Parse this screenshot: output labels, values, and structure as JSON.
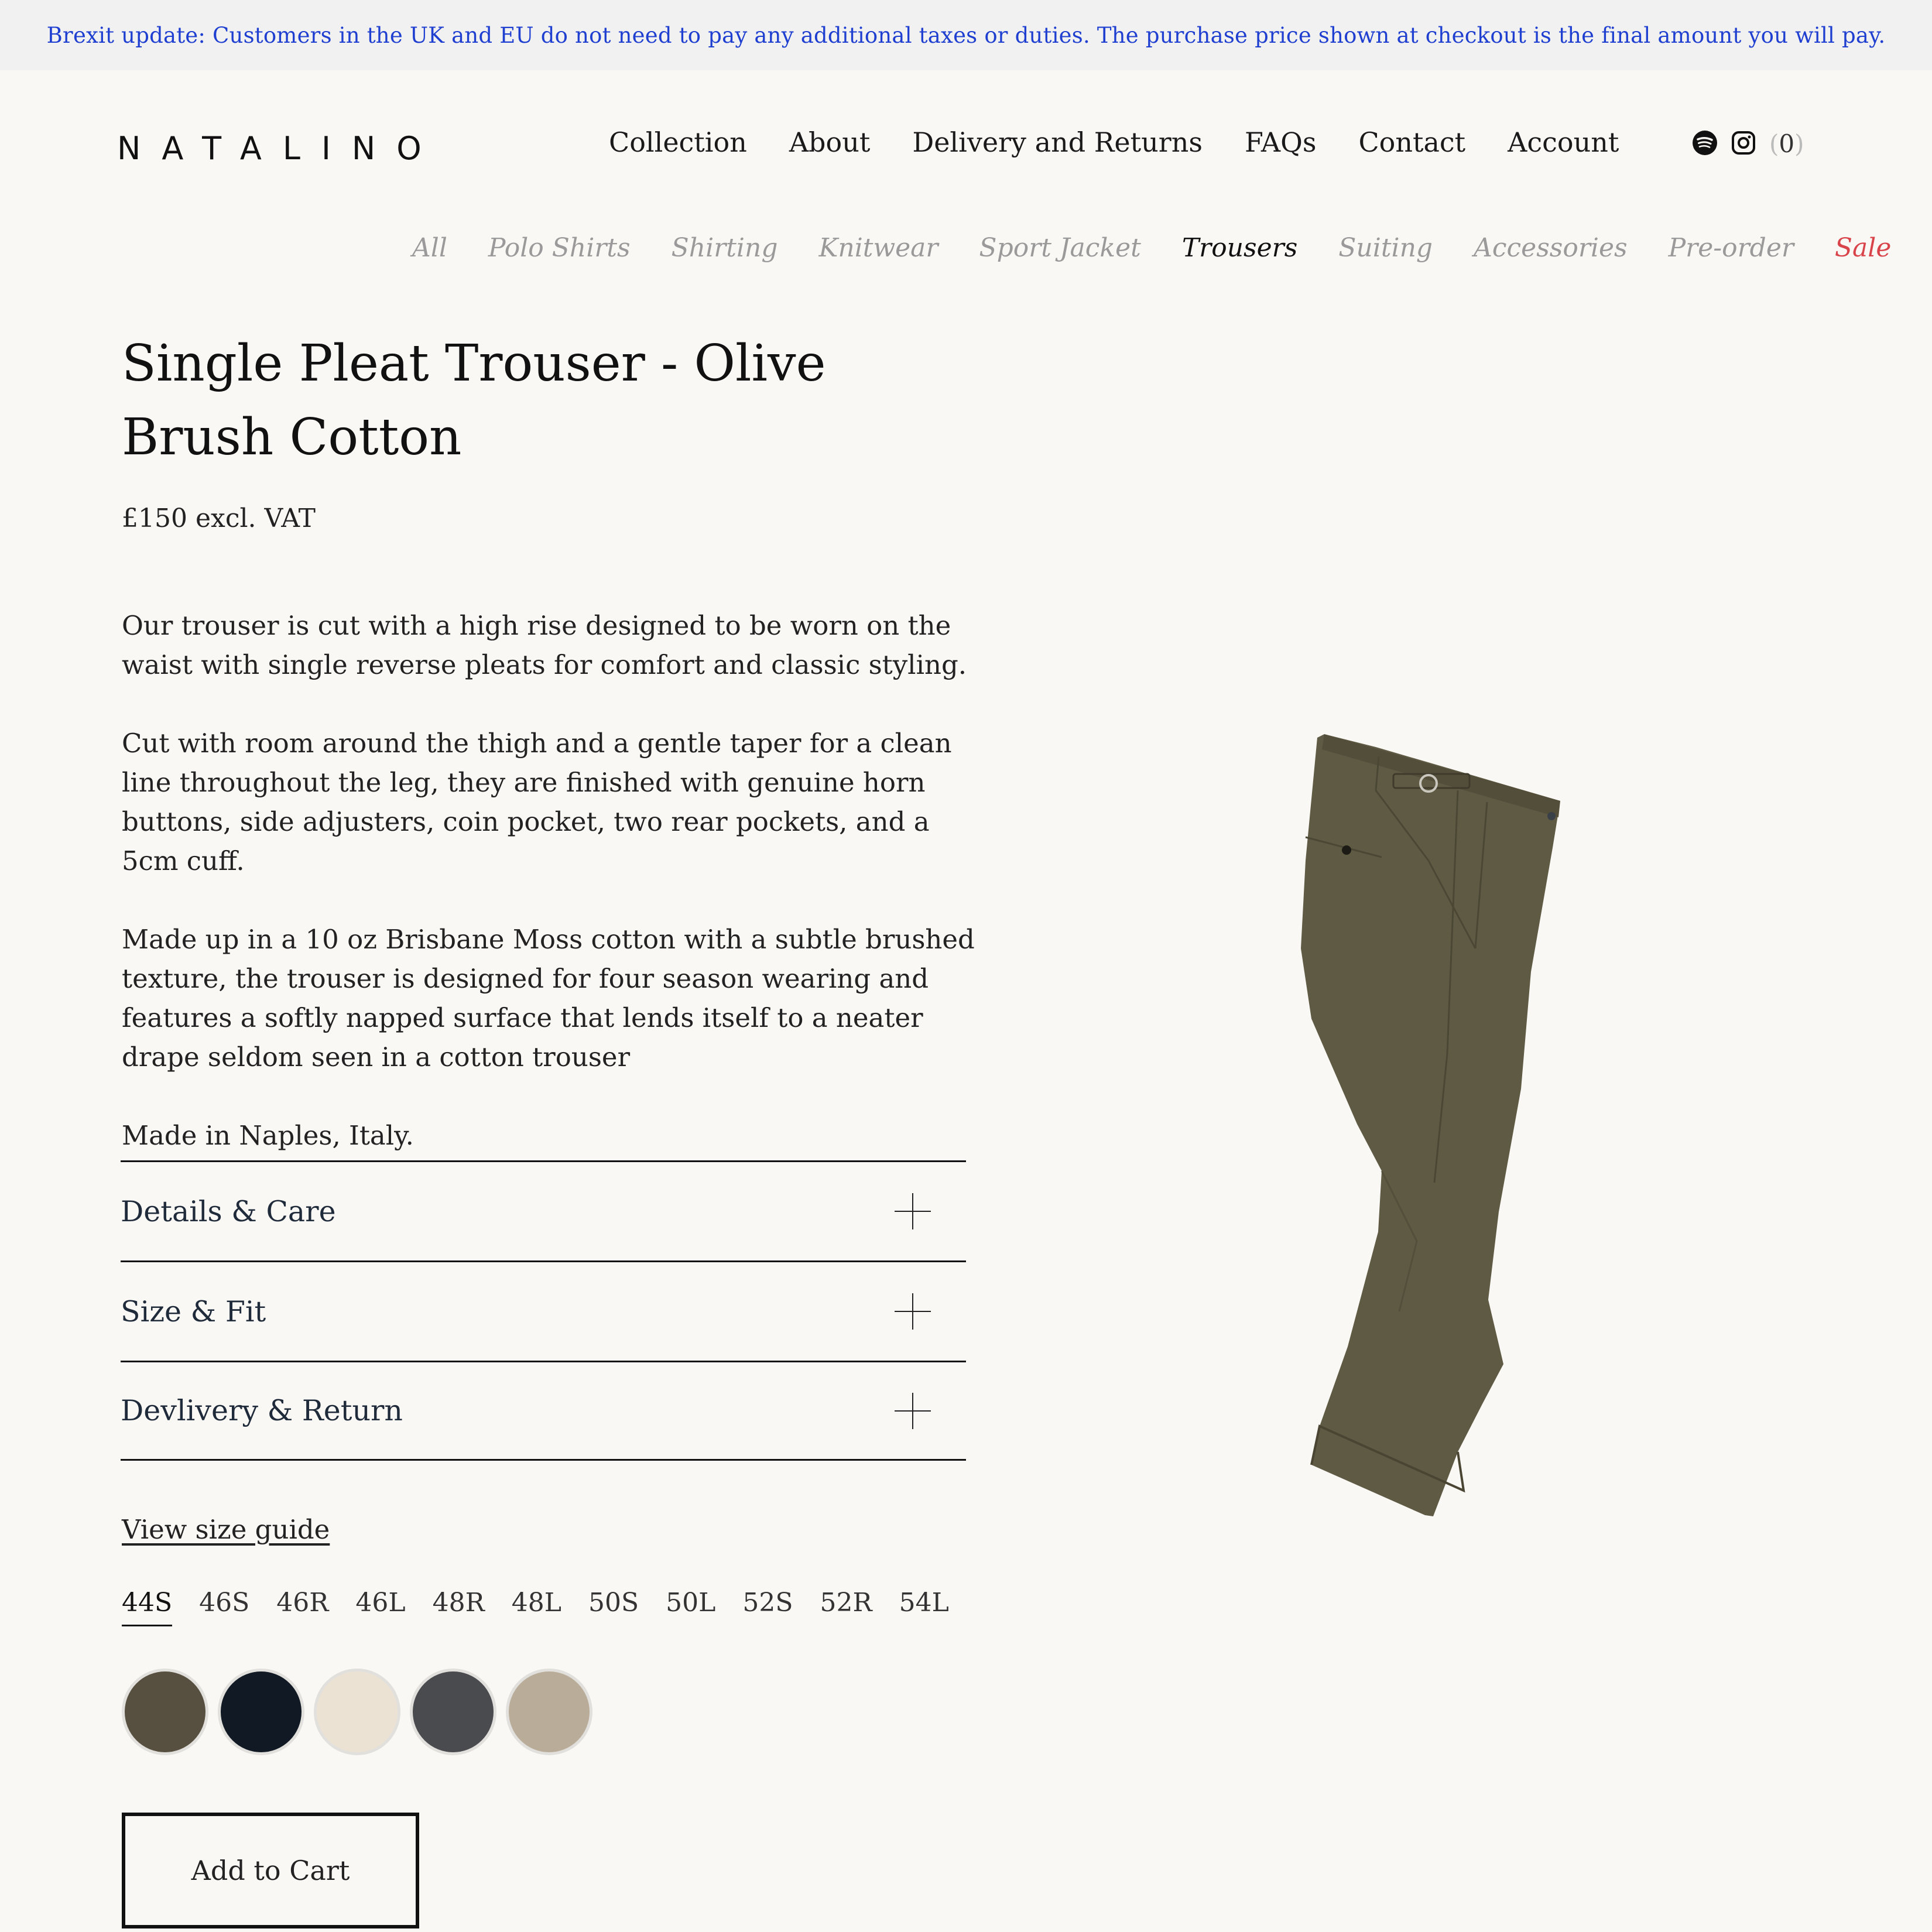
{
  "banner": {
    "text": "Brexit update: Customers in the UK and EU do not need to pay any additional taxes or duties. The purchase price shown at checkout is the final amount you will pay."
  },
  "header": {
    "logo": "NATALINO",
    "nav": [
      "Collection",
      "About",
      "Delivery and Returns",
      "FAQs",
      "Contact",
      "Account"
    ],
    "icons": [
      "spotify-icon",
      "instagram-icon"
    ],
    "cart_count": "0"
  },
  "categories": {
    "items": [
      "All",
      "Polo Shirts",
      "Shirting",
      "Knitwear",
      "Sport Jacket",
      "Trousers",
      "Suiting",
      "Accessories",
      "Pre-order",
      "Sale"
    ],
    "active": "Trousers",
    "sale_color": "#d9434a"
  },
  "product": {
    "title": "Single Pleat Trouser - Olive Brush Cotton",
    "price": "£150 excl. VAT",
    "description": [
      "Our trouser is cut with a high rise designed to be worn on the waist with single reverse pleats for comfort and classic styling.",
      "Cut with room around the thigh and a gentle taper for a clean line throughout the leg, they are finished with genuine horn buttons, side adjusters, coin pocket, two rear pockets, and a 5cm cuff.",
      "Made up in a 10 oz Brisbane Moss cotton with a subtle brushed texture, the trouser is designed for four season wearing and features a softly napped surface that lends itself to a neater drape seldom seen in a cotton trouser",
      "Made in Naples, Italy."
    ],
    "accordion": [
      "Details & Care",
      "Size & Fit",
      "Devlivery & Return"
    ],
    "size_guide": "View size guide",
    "sizes": [
      "44S",
      "46S",
      "46R",
      "46L",
      "48R",
      "48L",
      "50S",
      "50L",
      "52S",
      "52R",
      "54L"
    ],
    "selected_size": "44S",
    "swatches": [
      "#575040",
      "#111a24",
      "#ece2d4",
      "#4a4b4f",
      "#b9ad9a"
    ],
    "add_to_cart": "Add to Cart",
    "image_color": "#5f5a44"
  }
}
